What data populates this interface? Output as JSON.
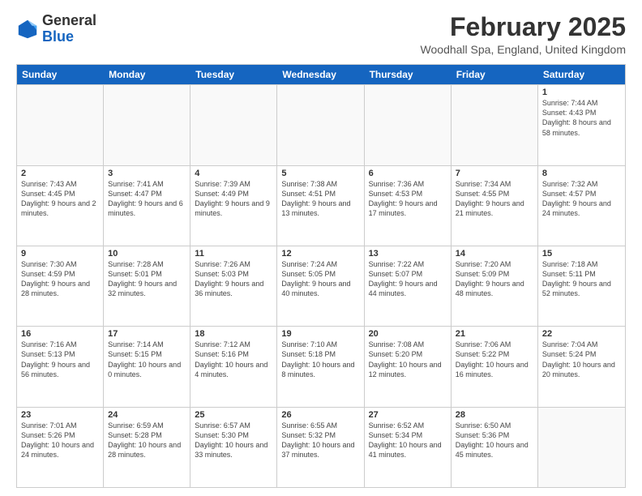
{
  "header": {
    "logo": {
      "general": "General",
      "blue": "Blue"
    },
    "title": "February 2025",
    "location": "Woodhall Spa, England, United Kingdom"
  },
  "days_of_week": [
    "Sunday",
    "Monday",
    "Tuesday",
    "Wednesday",
    "Thursday",
    "Friday",
    "Saturday"
  ],
  "weeks": [
    [
      {
        "day": "",
        "empty": true
      },
      {
        "day": "",
        "empty": true
      },
      {
        "day": "",
        "empty": true
      },
      {
        "day": "",
        "empty": true
      },
      {
        "day": "",
        "empty": true
      },
      {
        "day": "",
        "empty": true
      },
      {
        "day": "1",
        "sunrise": "Sunrise: 7:44 AM",
        "sunset": "Sunset: 4:43 PM",
        "daylight": "Daylight: 8 hours and 58 minutes."
      }
    ],
    [
      {
        "day": "2",
        "sunrise": "Sunrise: 7:43 AM",
        "sunset": "Sunset: 4:45 PM",
        "daylight": "Daylight: 9 hours and 2 minutes."
      },
      {
        "day": "3",
        "sunrise": "Sunrise: 7:41 AM",
        "sunset": "Sunset: 4:47 PM",
        "daylight": "Daylight: 9 hours and 6 minutes."
      },
      {
        "day": "4",
        "sunrise": "Sunrise: 7:39 AM",
        "sunset": "Sunset: 4:49 PM",
        "daylight": "Daylight: 9 hours and 9 minutes."
      },
      {
        "day": "5",
        "sunrise": "Sunrise: 7:38 AM",
        "sunset": "Sunset: 4:51 PM",
        "daylight": "Daylight: 9 hours and 13 minutes."
      },
      {
        "day": "6",
        "sunrise": "Sunrise: 7:36 AM",
        "sunset": "Sunset: 4:53 PM",
        "daylight": "Daylight: 9 hours and 17 minutes."
      },
      {
        "day": "7",
        "sunrise": "Sunrise: 7:34 AM",
        "sunset": "Sunset: 4:55 PM",
        "daylight": "Daylight: 9 hours and 21 minutes."
      },
      {
        "day": "8",
        "sunrise": "Sunrise: 7:32 AM",
        "sunset": "Sunset: 4:57 PM",
        "daylight": "Daylight: 9 hours and 24 minutes."
      }
    ],
    [
      {
        "day": "9",
        "sunrise": "Sunrise: 7:30 AM",
        "sunset": "Sunset: 4:59 PM",
        "daylight": "Daylight: 9 hours and 28 minutes."
      },
      {
        "day": "10",
        "sunrise": "Sunrise: 7:28 AM",
        "sunset": "Sunset: 5:01 PM",
        "daylight": "Daylight: 9 hours and 32 minutes."
      },
      {
        "day": "11",
        "sunrise": "Sunrise: 7:26 AM",
        "sunset": "Sunset: 5:03 PM",
        "daylight": "Daylight: 9 hours and 36 minutes."
      },
      {
        "day": "12",
        "sunrise": "Sunrise: 7:24 AM",
        "sunset": "Sunset: 5:05 PM",
        "daylight": "Daylight: 9 hours and 40 minutes."
      },
      {
        "day": "13",
        "sunrise": "Sunrise: 7:22 AM",
        "sunset": "Sunset: 5:07 PM",
        "daylight": "Daylight: 9 hours and 44 minutes."
      },
      {
        "day": "14",
        "sunrise": "Sunrise: 7:20 AM",
        "sunset": "Sunset: 5:09 PM",
        "daylight": "Daylight: 9 hours and 48 minutes."
      },
      {
        "day": "15",
        "sunrise": "Sunrise: 7:18 AM",
        "sunset": "Sunset: 5:11 PM",
        "daylight": "Daylight: 9 hours and 52 minutes."
      }
    ],
    [
      {
        "day": "16",
        "sunrise": "Sunrise: 7:16 AM",
        "sunset": "Sunset: 5:13 PM",
        "daylight": "Daylight: 9 hours and 56 minutes."
      },
      {
        "day": "17",
        "sunrise": "Sunrise: 7:14 AM",
        "sunset": "Sunset: 5:15 PM",
        "daylight": "Daylight: 10 hours and 0 minutes."
      },
      {
        "day": "18",
        "sunrise": "Sunrise: 7:12 AM",
        "sunset": "Sunset: 5:16 PM",
        "daylight": "Daylight: 10 hours and 4 minutes."
      },
      {
        "day": "19",
        "sunrise": "Sunrise: 7:10 AM",
        "sunset": "Sunset: 5:18 PM",
        "daylight": "Daylight: 10 hours and 8 minutes."
      },
      {
        "day": "20",
        "sunrise": "Sunrise: 7:08 AM",
        "sunset": "Sunset: 5:20 PM",
        "daylight": "Daylight: 10 hours and 12 minutes."
      },
      {
        "day": "21",
        "sunrise": "Sunrise: 7:06 AM",
        "sunset": "Sunset: 5:22 PM",
        "daylight": "Daylight: 10 hours and 16 minutes."
      },
      {
        "day": "22",
        "sunrise": "Sunrise: 7:04 AM",
        "sunset": "Sunset: 5:24 PM",
        "daylight": "Daylight: 10 hours and 20 minutes."
      }
    ],
    [
      {
        "day": "23",
        "sunrise": "Sunrise: 7:01 AM",
        "sunset": "Sunset: 5:26 PM",
        "daylight": "Daylight: 10 hours and 24 minutes."
      },
      {
        "day": "24",
        "sunrise": "Sunrise: 6:59 AM",
        "sunset": "Sunset: 5:28 PM",
        "daylight": "Daylight: 10 hours and 28 minutes."
      },
      {
        "day": "25",
        "sunrise": "Sunrise: 6:57 AM",
        "sunset": "Sunset: 5:30 PM",
        "daylight": "Daylight: 10 hours and 33 minutes."
      },
      {
        "day": "26",
        "sunrise": "Sunrise: 6:55 AM",
        "sunset": "Sunset: 5:32 PM",
        "daylight": "Daylight: 10 hours and 37 minutes."
      },
      {
        "day": "27",
        "sunrise": "Sunrise: 6:52 AM",
        "sunset": "Sunset: 5:34 PM",
        "daylight": "Daylight: 10 hours and 41 minutes."
      },
      {
        "day": "28",
        "sunrise": "Sunrise: 6:50 AM",
        "sunset": "Sunset: 5:36 PM",
        "daylight": "Daylight: 10 hours and 45 minutes."
      },
      {
        "day": "",
        "empty": true
      }
    ]
  ]
}
